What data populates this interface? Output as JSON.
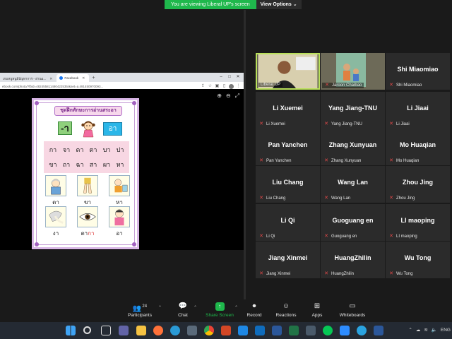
{
  "banner": {
    "viewing_text": "You are viewing Liberal UP's screen",
    "view_options": "View Options"
  },
  "browser": {
    "tabs": [
      {
        "label": "เกมหนูหนูมีปัญหาการ - อ่าน&...",
        "active": false
      },
      {
        "label": "Facebook",
        "active": true
      }
    ],
    "new_tab": "+",
    "url": "ebook.com/photo/?fbid=482455811480422535/&set=a.491450970093..."
  },
  "worksheet": {
    "title": "ชุดฝึกทักษะการอ่านสระอา",
    "minus_label": "-า",
    "aa_label": "อา",
    "row1": [
      "กา",
      "จา",
      "ดา",
      "ตา",
      "บา",
      "ปา"
    ],
    "row2": [
      "ขา",
      "ถา",
      "ฉา",
      "สา",
      "ผา",
      "หา"
    ],
    "pictures": [
      {
        "label": "ตา",
        "icon": "old-man-icon"
      },
      {
        "label": "ขา",
        "icon": "legs-icon"
      },
      {
        "label": "หา",
        "icon": "searching-child-icon"
      },
      {
        "label": "งา",
        "icon": "tusk-icon"
      },
      {
        "label_prefix": "ตา",
        "label_suffix": "กา",
        "icon": "eye-icon"
      },
      {
        "label": "อา",
        "icon": "aunt-icon"
      }
    ]
  },
  "gallery": {
    "participants": [
      {
        "display": "",
        "label": "Liberal UP",
        "video": true,
        "active": true
      },
      {
        "display": "",
        "label": "Jaroon Chaibao",
        "video": true,
        "active": false
      },
      {
        "display": "Shi Miaomiao",
        "label": "Shi Miaomiao",
        "video": false
      },
      {
        "display": "Li Xuemei",
        "label": "Li Xuemei",
        "video": false
      },
      {
        "display": "Yang Jiang-TNU",
        "label": "Yang Jiang-TNU",
        "video": false
      },
      {
        "display": "Li Jiaai",
        "label": "Li Jiaai",
        "video": false
      },
      {
        "display": "Pan Yanchen",
        "label": "Pan Yanchen",
        "video": false
      },
      {
        "display": "Zhang Xunyuan",
        "label": "Zhang Xunyuan",
        "video": false
      },
      {
        "display": "Mo Huaqian",
        "label": "Mo Huaqian",
        "video": false
      },
      {
        "display": "Liu Chang",
        "label": "Liu Chang",
        "video": false
      },
      {
        "display": "Wang Lan",
        "label": "Wang Lan",
        "video": false
      },
      {
        "display": "Zhou Jing",
        "label": "Zhou Jing",
        "video": false
      },
      {
        "display": "Li Qi",
        "label": "Li Qi",
        "video": false
      },
      {
        "display": "Guoguang en",
        "label": "Guoguang en",
        "video": false
      },
      {
        "display": "LI maoping",
        "label": "LI maoping",
        "video": false
      },
      {
        "display": "Jiang Xinmei",
        "label": "Jiang Xinmei",
        "video": false
      },
      {
        "display": "HuangZhilin",
        "label": "HuangZhilin",
        "video": false
      },
      {
        "display": "Wu Tong",
        "label": "Wu Tong",
        "video": false
      }
    ]
  },
  "toolbar": {
    "participants_label": "Participants",
    "participants_count": "24",
    "chat_label": "Chat",
    "share_label": "Share Screen",
    "record_label": "Record",
    "reactions_label": "Reactions",
    "apps_label": "Apps",
    "whiteboards_label": "Whiteboards"
  },
  "taskbar": {
    "lang": "ENG"
  },
  "colors": {
    "zoom_green": "#1fb84c",
    "active_border": "#b9e05a",
    "mute_red": "#e04848"
  }
}
